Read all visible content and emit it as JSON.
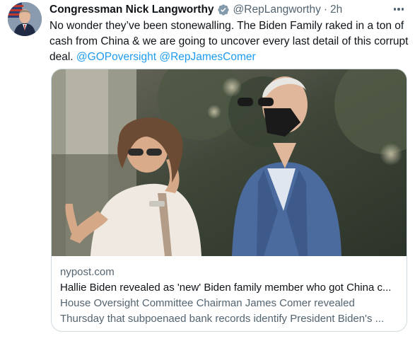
{
  "tweet": {
    "author_name": "Congressman Nick Langworthy",
    "handle": "@RepLangworthy",
    "separator": "·",
    "time": "2h",
    "text_line_1": "No wonder they’ve been stonewalling. The Biden Family raked in a ton of",
    "text_line_2": "cash from China & we are going to uncover every last detail of this corrupt",
    "text_line_3_plain": "deal. ",
    "mention_1": "@GOPoversight",
    "mention_2": "@RepJamesComer",
    "icons": {
      "verified": "verified-badge-icon",
      "more": "more-options-icon"
    },
    "accent_color": "#1d9bf0"
  },
  "card": {
    "domain": "nypost.com",
    "title": "Hallie Biden revealed as 'new' Biden family member who got China c...",
    "description_line_1": "House Oversight Committee Chairman James Comer revealed",
    "description_line_2": "Thursday that subpoenaed bank records identify President Biden's ..."
  }
}
